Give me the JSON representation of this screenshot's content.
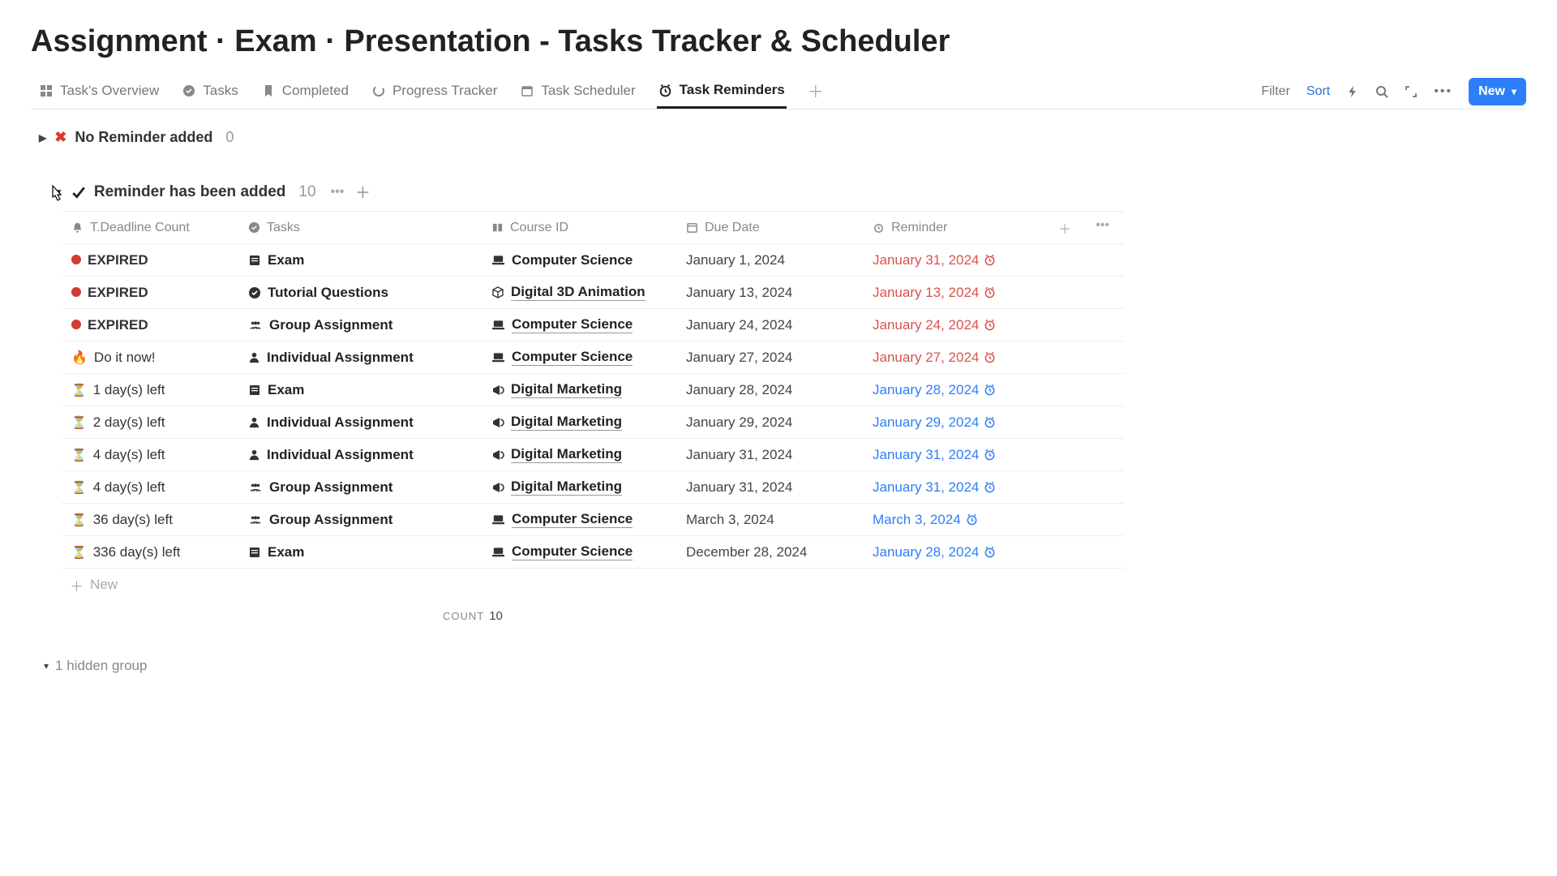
{
  "title": "Assignment · Exam · Presentation - Tasks Tracker & Scheduler",
  "tabs": {
    "overview": "Task's Overview",
    "tasks": "Tasks",
    "completed": "Completed",
    "progress": "Progress Tracker",
    "scheduler": "Task Scheduler",
    "reminders": "Task Reminders"
  },
  "toolbar": {
    "filter": "Filter",
    "sort": "Sort",
    "new": "New"
  },
  "groups": {
    "no_reminder": {
      "label": "No Reminder added",
      "count": "0"
    },
    "added": {
      "label": "Reminder has been added",
      "count": "10"
    }
  },
  "columns": {
    "deadline": "T.Deadline Count",
    "tasks": "Tasks",
    "course": "Course ID",
    "due": "Due Date",
    "reminder": "Reminder"
  },
  "rows": [
    {
      "status": "EXPIRED",
      "status_kind": "expired",
      "task": "Exam",
      "task_icon": "book",
      "course": "Computer Science",
      "course_icon": "laptop",
      "course_und": false,
      "due": "January 1, 2024",
      "reminder": "January 31, 2024",
      "rem_color": "red"
    },
    {
      "status": "EXPIRED",
      "status_kind": "expired",
      "task": "Tutorial Questions",
      "task_icon": "check",
      "course": "Digital 3D Animation",
      "course_icon": "cube",
      "course_und": true,
      "due": "January 13, 2024",
      "reminder": "January 13, 2024",
      "rem_color": "red"
    },
    {
      "status": "EXPIRED",
      "status_kind": "expired",
      "task": "Group Assignment",
      "task_icon": "group",
      "course": "Computer Science",
      "course_icon": "laptop",
      "course_und": true,
      "due": "January 24, 2024",
      "reminder": "January 24, 2024",
      "rem_color": "red"
    },
    {
      "status": "Do it now!",
      "status_kind": "fire",
      "task": "Individual Assignment",
      "task_icon": "person",
      "course": "Computer Science",
      "course_icon": "laptop",
      "course_und": true,
      "due": "January 27, 2024",
      "reminder": "January 27, 2024",
      "rem_color": "red"
    },
    {
      "status": "1 day(s) left",
      "status_kind": "hourglass",
      "task": "Exam",
      "task_icon": "book",
      "course": "Digital Marketing",
      "course_icon": "megaphone",
      "course_und": true,
      "due": "January 28, 2024",
      "reminder": "January 28, 2024",
      "rem_color": "blue"
    },
    {
      "status": "2 day(s) left",
      "status_kind": "hourglass",
      "task": "Individual Assignment",
      "task_icon": "person",
      "course": "Digital Marketing",
      "course_icon": "megaphone",
      "course_und": true,
      "due": "January 29, 2024",
      "reminder": "January 29, 2024",
      "rem_color": "blue"
    },
    {
      "status": "4 day(s) left",
      "status_kind": "hourglass",
      "task": "Individual Assignment",
      "task_icon": "person",
      "course": "Digital Marketing",
      "course_icon": "megaphone",
      "course_und": true,
      "due": "January 31, 2024",
      "reminder": "January 31, 2024",
      "rem_color": "blue"
    },
    {
      "status": "4 day(s) left",
      "status_kind": "hourglass",
      "task": "Group Assignment",
      "task_icon": "group",
      "course": "Digital Marketing",
      "course_icon": "megaphone",
      "course_und": true,
      "due": "January 31, 2024",
      "reminder": "January 31, 2024",
      "rem_color": "blue"
    },
    {
      "status": "36 day(s) left",
      "status_kind": "hourglass",
      "task": "Group Assignment",
      "task_icon": "group",
      "course": "Computer Science",
      "course_icon": "laptop",
      "course_und": true,
      "due": "March 3, 2024",
      "reminder": "March 3, 2024",
      "rem_color": "blue"
    },
    {
      "status": "336 day(s) left",
      "status_kind": "hourglass",
      "task": "Exam",
      "task_icon": "book",
      "course": "Computer Science",
      "course_icon": "laptop",
      "course_und": true,
      "due": "December 28, 2024",
      "reminder": "January 28, 2024",
      "rem_color": "blue"
    }
  ],
  "footer": {
    "new_row": "New",
    "count_label": "COUNT",
    "count_val": "10",
    "hidden": "1 hidden group"
  }
}
